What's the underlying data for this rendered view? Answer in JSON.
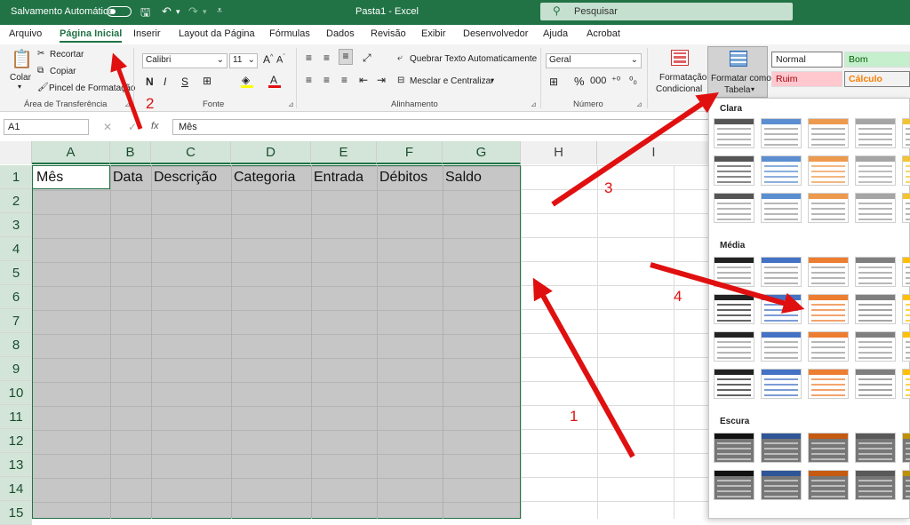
{
  "titlebar": {
    "autosave_label": "Salvamento Automático",
    "file_title": "Pasta1  -  Excel",
    "search_placeholder": "Pesquisar"
  },
  "tabs": [
    "Arquivo",
    "Página Inicial",
    "Inserir",
    "Layout da Página",
    "Fórmulas",
    "Dados",
    "Revisão",
    "Exibir",
    "Desenvolvedor",
    "Ajuda",
    "Acrobat"
  ],
  "ribbon": {
    "clipboard": {
      "paste": "Colar",
      "cut": "Recortar",
      "copy": "Copiar",
      "format_painter": "Pincel de Formatação",
      "group": "Área de Transferência"
    },
    "font": {
      "name": "Calibri",
      "size": "11",
      "group": "Fonte"
    },
    "alignment": {
      "wrap": "Quebrar Texto Automaticamente",
      "merge": "Mesclar e Centralizar",
      "group": "Alinhamento"
    },
    "number": {
      "format": "Geral",
      "group": "Número"
    },
    "conditional": {
      "line1": "Formatação",
      "line2": "Condicional"
    },
    "format_table": {
      "line1": "Formatar como",
      "line2": "Tabela"
    },
    "styles": {
      "normal": "Normal",
      "bom": "Bom",
      "ruim": "Ruim",
      "calculo": "Cálculo"
    }
  },
  "formula_bar": {
    "name_box": "A1",
    "fx": "fx",
    "content": "Mês"
  },
  "columns": [
    "A",
    "B",
    "C",
    "D",
    "E",
    "F",
    "G",
    "H",
    "I"
  ],
  "rows": [
    "1",
    "2",
    "3",
    "4",
    "5",
    "6",
    "7",
    "8",
    "9",
    "10",
    "11",
    "12",
    "13",
    "14",
    "15"
  ],
  "header_cells": [
    "Mês",
    "Data",
    "Descrição",
    "Categoria",
    "Entrada",
    "Débitos",
    "Saldo"
  ],
  "gallery": {
    "clara": "Clara",
    "media": "Média",
    "escura": "Escura"
  },
  "annotations": [
    "1",
    "2",
    "3",
    "4"
  ],
  "colors": {
    "accent": "#217346",
    "annotation": "#e01010",
    "selection": "#c6c6c6"
  }
}
